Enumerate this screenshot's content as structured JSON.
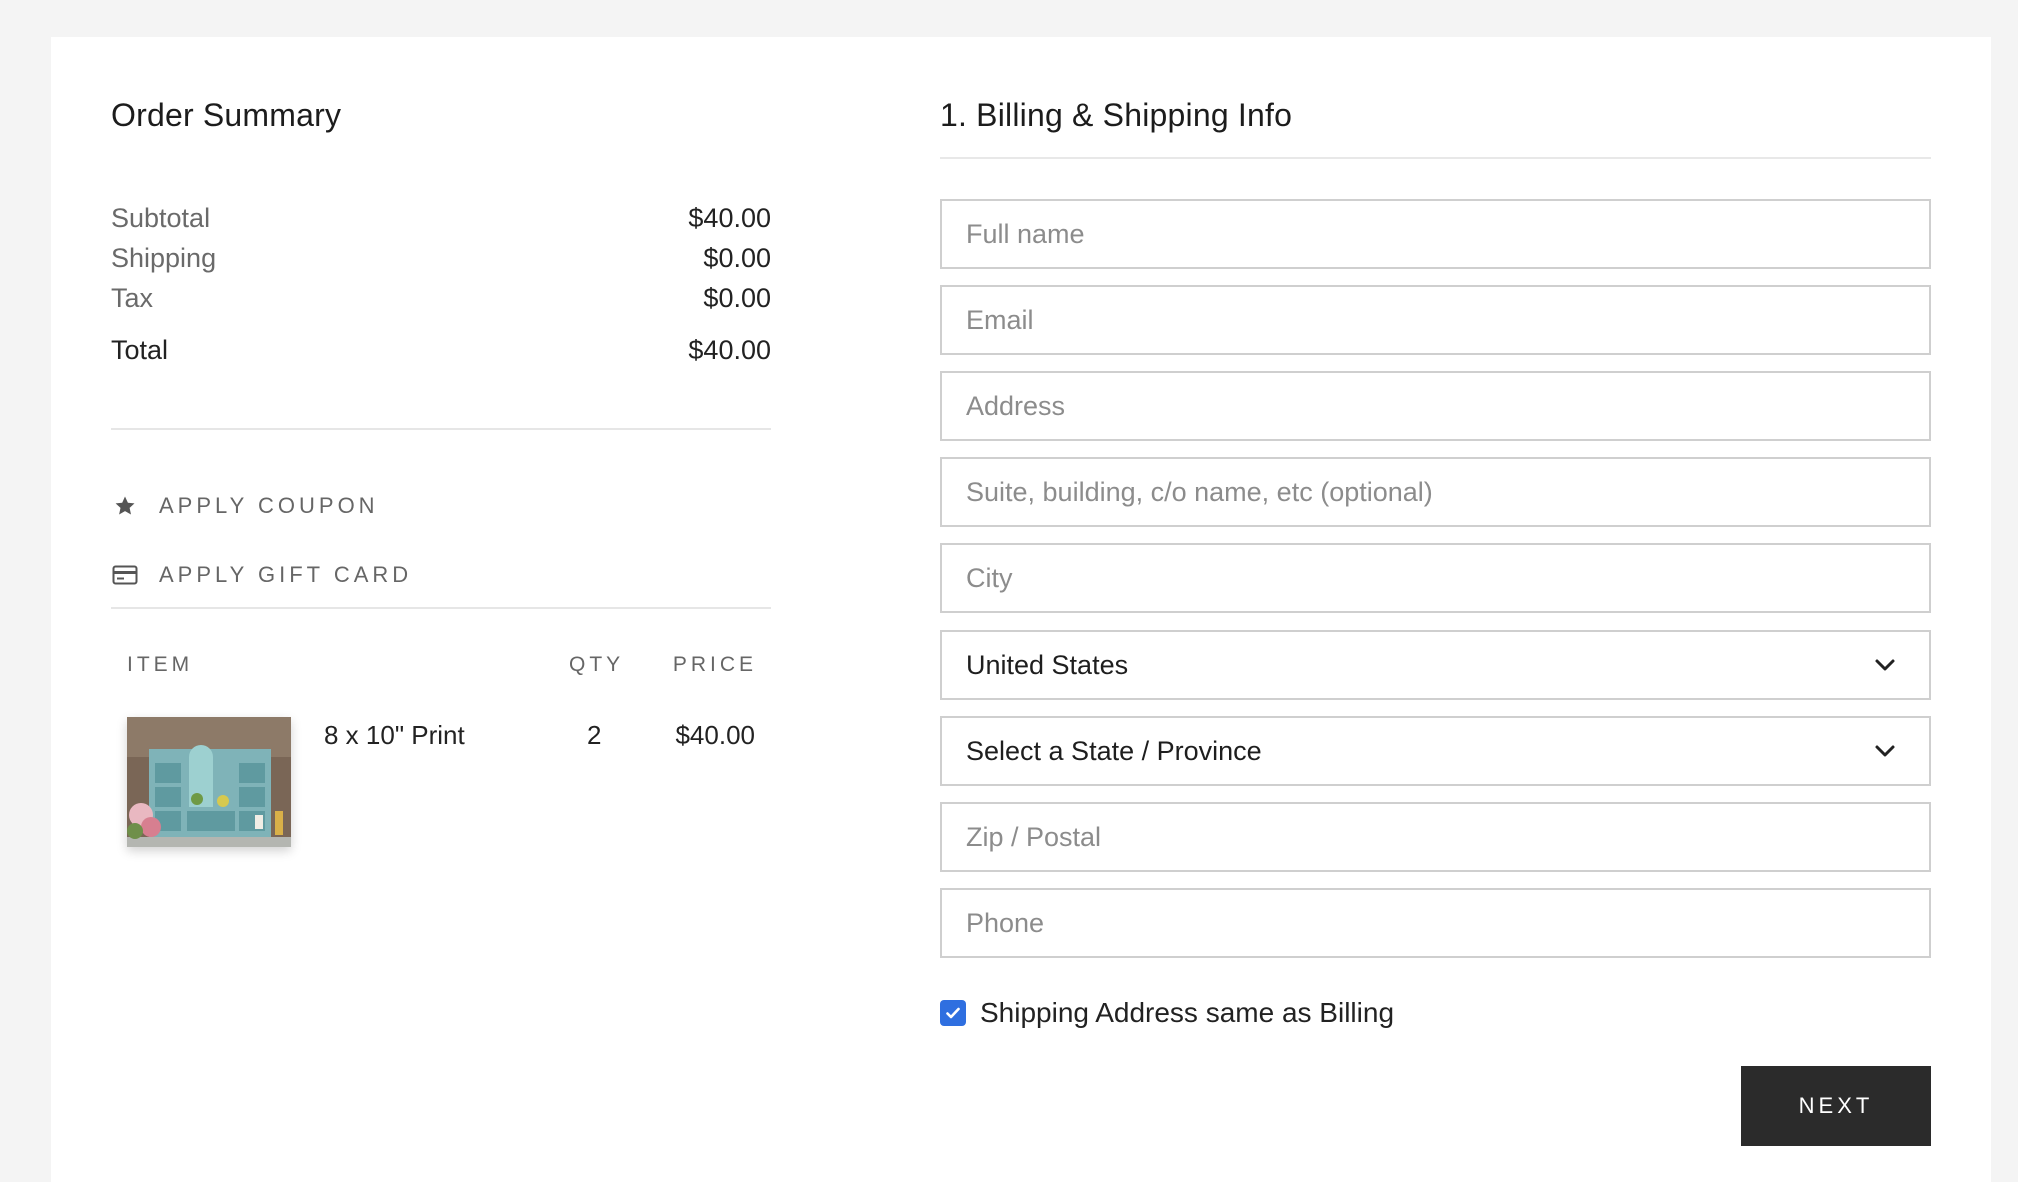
{
  "order_summary": {
    "title": "Order Summary",
    "subtotal_label": "Subtotal",
    "subtotal_value": "$40.00",
    "shipping_label": "Shipping",
    "shipping_value": "$0.00",
    "tax_label": "Tax",
    "tax_value": "$0.00",
    "total_label": "Total",
    "total_value": "$40.00",
    "apply_coupon": {
      "label": "APPLY COUPON",
      "icon": "star-icon"
    },
    "apply_gift_card": {
      "label": "APPLY GIFT CARD",
      "icon": "credit-card-icon"
    },
    "table": {
      "col_item": "ITEM",
      "col_qty": "QTY",
      "col_price": "PRICE",
      "items": [
        {
          "name": "8 x 10\" Print",
          "qty": "2",
          "price": "$40.00",
          "thumbnail": "photo of a teal display shelf with plants"
        }
      ]
    }
  },
  "billing": {
    "title": "1. Billing & Shipping Info",
    "full_name_placeholder": "Full name",
    "email_placeholder": "Email",
    "address_placeholder": "Address",
    "suite_placeholder": "Suite, building, c/o name, etc (optional)",
    "city_placeholder": "City",
    "country_selected": "United States",
    "state_selected": "Select a State / Province",
    "zip_placeholder": "Zip / Postal",
    "phone_placeholder": "Phone",
    "same_as_billing_label": "Shipping Address same as Billing",
    "same_as_billing_checked": true,
    "next_button": "NEXT"
  },
  "colors": {
    "background": "#f4f4f4",
    "card": "#ffffff",
    "checkbox_accent": "#2f6fe0",
    "button_bg": "#2b2b2b",
    "button_text": "#ffffff"
  }
}
